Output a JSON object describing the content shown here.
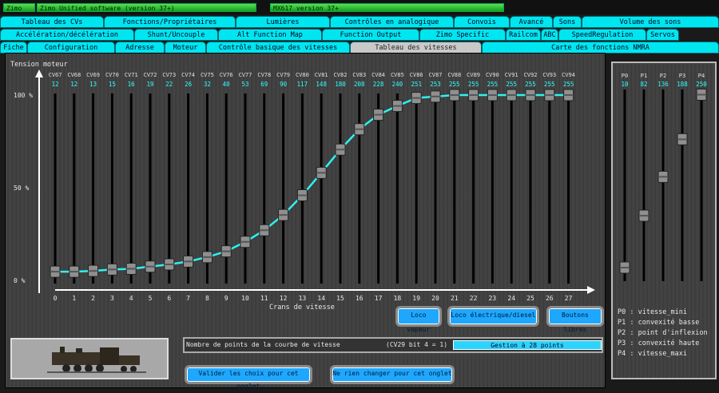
{
  "topbar": {
    "brand": "Zimo",
    "software": "Zimo Unified software (version 37+)",
    "version": "MX617 version 37+"
  },
  "tabs_row1": [
    "Tableau des CVs",
    "Fonctions/Propriétaires",
    "Lumières",
    "Contrôles en analogique",
    "Convois",
    "Avancé",
    "Sons",
    "Volume des sons"
  ],
  "tabs_row2": [
    "Accélération/décélération",
    "Shunt/Uncouple",
    "Alt Function Map",
    "Function Output",
    "Zimo Specific",
    "Railcom",
    "ABC",
    "SpeedRegulation",
    "Servos"
  ],
  "tabs_row3": [
    "Fiche",
    "Configuration",
    "Adresse",
    "Moteur",
    "Contrôle basique des vitesses",
    "Tableau des vitesses",
    "Carte des fonctions NMRA"
  ],
  "active_tab": "Tableau des vitesses",
  "chart": {
    "ylabel": "Tension moteur",
    "xlabel": "Crans de vitesse",
    "yticks": [
      "100 %",
      "50 %",
      "0 %"
    ],
    "cvs": [
      "CV67",
      "CV68",
      "CV69",
      "CV70",
      "CV71",
      "CV72",
      "CV73",
      "CV74",
      "CV75",
      "CV76",
      "CV77",
      "CV78",
      "CV79",
      "CV80",
      "CV81",
      "CV82",
      "CV83",
      "CV84",
      "CV85",
      "CV86",
      "CV87",
      "CV88",
      "CV89",
      "CV90",
      "CV91",
      "CV92",
      "CV93",
      "CV94"
    ],
    "values": [
      12,
      12,
      13,
      15,
      16,
      19,
      22,
      26,
      32,
      40,
      53,
      69,
      90,
      117,
      148,
      180,
      208,
      228,
      240,
      251,
      253,
      255,
      255,
      255,
      255,
      255,
      255,
      255
    ],
    "steps": [
      "0",
      "1",
      "2",
      "3",
      "4",
      "5",
      "6",
      "7",
      "8",
      "9",
      "10",
      "11",
      "12",
      "13",
      "14",
      "15",
      "16",
      "17",
      "18",
      "19",
      "20",
      "21",
      "22",
      "23",
      "24",
      "25",
      "26",
      "27"
    ]
  },
  "params": {
    "labels": [
      "P0",
      "P1",
      "P2",
      "P3",
      "P4"
    ],
    "values": [
      10,
      82,
      136,
      188,
      250
    ],
    "legend": [
      "P0 : vitesse_mini",
      "P1 : convexité basse",
      "P2 : point d'inflexion",
      "P3 : convexité haute",
      "P4 : vitesse_maxi"
    ]
  },
  "buttons": {
    "vapeur": "Loco vapeur",
    "electrique": "Loco électrique/diesel",
    "libres": "Boutons libres",
    "valider": "Valider les choix pour cet onglet",
    "annuler": "Ne rien changer pour cet onglet"
  },
  "points": {
    "label": "Nombre de points de la courbe de vitesse",
    "cv29": "(CV29 bit 4 = 1)",
    "value": "Gestion à 28 points"
  },
  "colors": {
    "accent": "#00e6f0",
    "curve": "#30f0f0"
  }
}
